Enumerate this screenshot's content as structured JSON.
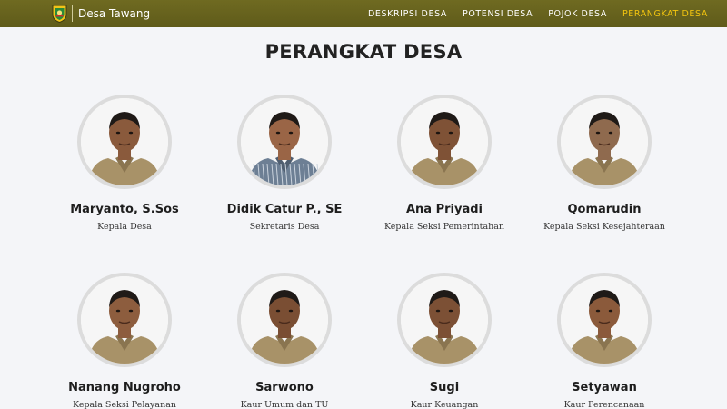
{
  "header": {
    "brand": "Desa Tawang",
    "nav": [
      "DESKRIPSI DESA",
      "POTENSI DESA",
      "POJOK DESA",
      "PERANGKAT DESA"
    ],
    "active_nav": "PERANGKAT DESA",
    "colors": {
      "bar": "#6b6620",
      "active": "#f2c40f"
    }
  },
  "page": {
    "title": "PERANGKAT DESA"
  },
  "officials": [
    {
      "name": "Maryanto, S.Sos",
      "role": "Kepala Desa",
      "attire": "khaki-uniform"
    },
    {
      "name": "Didik Catur P., SE",
      "role": "Sekretaris Desa",
      "attire": "striped-shirt"
    },
    {
      "name": "Ana Priyadi",
      "role": "Kepala Seksi Pemerintahan",
      "attire": "khaki-uniform"
    },
    {
      "name": "Qomarudin",
      "role": "Kepala Seksi Kesejahteraan",
      "attire": "khaki-uniform"
    },
    {
      "name": "Nanang Nugroho",
      "role": "Kepala Seksi Pelayanan",
      "attire": "khaki-uniform"
    },
    {
      "name": "Sarwono",
      "role": "Kaur Umum dan TU",
      "attire": "khaki-uniform"
    },
    {
      "name": "Sugi",
      "role": "Kaur Keuangan",
      "attire": "khaki-uniform"
    },
    {
      "name": "Setyawan",
      "role": "Kaur Perencanaan",
      "attire": "khaki-uniform"
    }
  ]
}
